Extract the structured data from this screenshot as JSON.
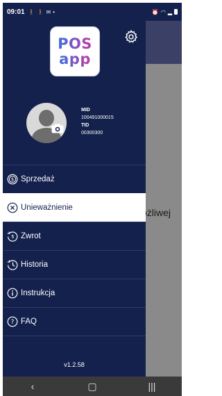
{
  "status_bar": {
    "time": "09:01",
    "left_icons": [
      "person-walk-icon",
      "person-walk-icon",
      "message-icon",
      "dot-icon"
    ],
    "right_icons": [
      "alarm-icon",
      "wifi-icon",
      "signal-icon",
      "battery-icon"
    ]
  },
  "drawer": {
    "logo": {
      "line1": "POS",
      "line2": "app"
    },
    "merchant": {
      "mid_label": "MID",
      "mid_value": "100491000015",
      "tid_label": "TID",
      "tid_value": "00300300"
    },
    "menu": [
      {
        "label": "Sprzedaż",
        "icon": "coin-icon",
        "active": false
      },
      {
        "label": "Unieważnienie",
        "icon": "cancel-circle-icon",
        "active": true
      },
      {
        "label": "Zwrot",
        "icon": "refund-icon",
        "active": false
      },
      {
        "label": "Historia",
        "icon": "history-icon",
        "active": false
      },
      {
        "label": "Instrukcja",
        "icon": "info-icon",
        "active": false
      },
      {
        "label": "FAQ",
        "icon": "question-icon",
        "active": false
      }
    ],
    "version": "v1.2.58"
  },
  "background": {
    "partial_text": "ożliwej"
  },
  "colors": {
    "drawer_bg": "#14214d",
    "active_item_bg": "#ffffff",
    "nav_bar_bg": "#3a3a3a"
  }
}
